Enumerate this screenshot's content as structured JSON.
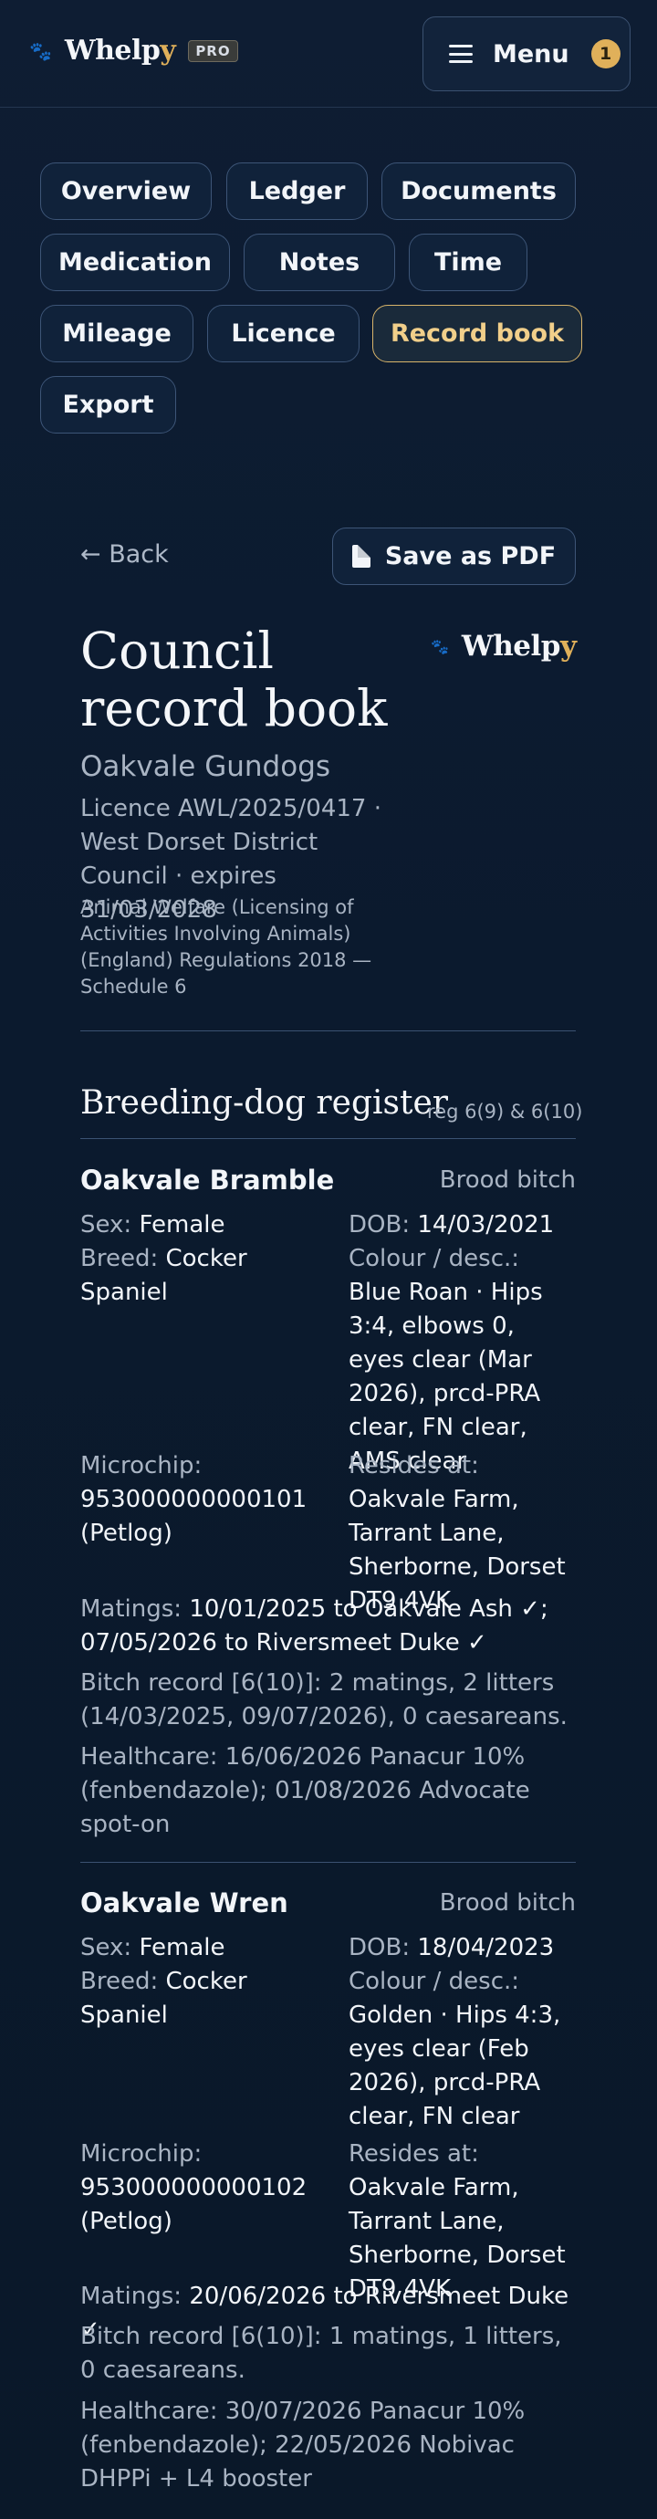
{
  "header": {
    "brand_main": "Whelp",
    "brand_end": "y",
    "pro_badge": "PRO",
    "menu_label": "Menu",
    "menu_count": "1"
  },
  "tabs": [
    {
      "label": "Overview"
    },
    {
      "label": "Ledger"
    },
    {
      "label": "Documents"
    },
    {
      "label": "Medication"
    },
    {
      "label": "Notes"
    },
    {
      "label": "Time"
    },
    {
      "label": "Mileage"
    },
    {
      "label": "Licence"
    },
    {
      "label": "Record book",
      "active": true
    },
    {
      "label": "Export"
    }
  ],
  "actions": {
    "back_label": "← Back",
    "save_pdf_label": "Save as PDF"
  },
  "document": {
    "title": "Council record book",
    "kennel": "Oakvale Gundogs",
    "licence_line": "Licence AWL/2025/0417 · West Dorset District Council · expires 31/03/2028",
    "regulations": "Animal Welfare (Licensing of Activities Involving Animals) (England) Regulations 2018 — Schedule 6",
    "section_title": "Breeding-dog register",
    "section_ref": "reg 6(9) & 6(10)"
  },
  "labels": {
    "sex": "Sex:",
    "dob": "DOB:",
    "breed": "Breed:",
    "colour": "Colour / desc.:",
    "microchip": "Microchip:",
    "resides": "Resides at:",
    "matings": "Matings:"
  },
  "dogs": [
    {
      "name": "Oakvale Bramble",
      "role": "Brood bitch",
      "sex": "Female",
      "dob": "14/03/2021",
      "breed": "Cocker Spaniel",
      "colour": "Blue Roan · Hips 3:4, elbows 0, eyes clear (Mar 2026), prcd-PRA clear, FN clear, AMS clear",
      "microchip": "953000000000101 (Petlog)",
      "resides": "Oakvale Farm, Tarrant Lane, Sherborne, Dorset DT9 4VK",
      "matings": "10/01/2025 to Oakvale Ash ✓; 07/05/2026 to Riversmeet Duke ✓",
      "bitch_record": "Bitch record [6(10)]: 2 matings, 2 litters (14/03/2025, 09/07/2026), 0 caesareans.",
      "healthcare": "Healthcare: 16/06/2026 Panacur 10% (fenbendazole); 01/08/2026 Advocate spot-on"
    },
    {
      "name": "Oakvale Wren",
      "role": "Brood bitch",
      "sex": "Female",
      "dob": "18/04/2023",
      "breed": "Cocker Spaniel",
      "colour": "Golden · Hips 4:3, eyes clear (Feb 2026), prcd-PRA clear, FN clear",
      "microchip": "953000000000102 (Petlog)",
      "resides": "Oakvale Farm, Tarrant Lane, Sherborne, Dorset DT9 4VK",
      "matings": "20/06/2026 to Riversmeet Duke ✓",
      "bitch_record": "Bitch record [6(10)]: 1 matings, 1 litters, 0 caesareans.",
      "healthcare": "Healthcare: 30/07/2026 Panacur 10% (fenbendazole); 22/05/2026 Nobivac DHPPi + L4 booster"
    }
  ]
}
